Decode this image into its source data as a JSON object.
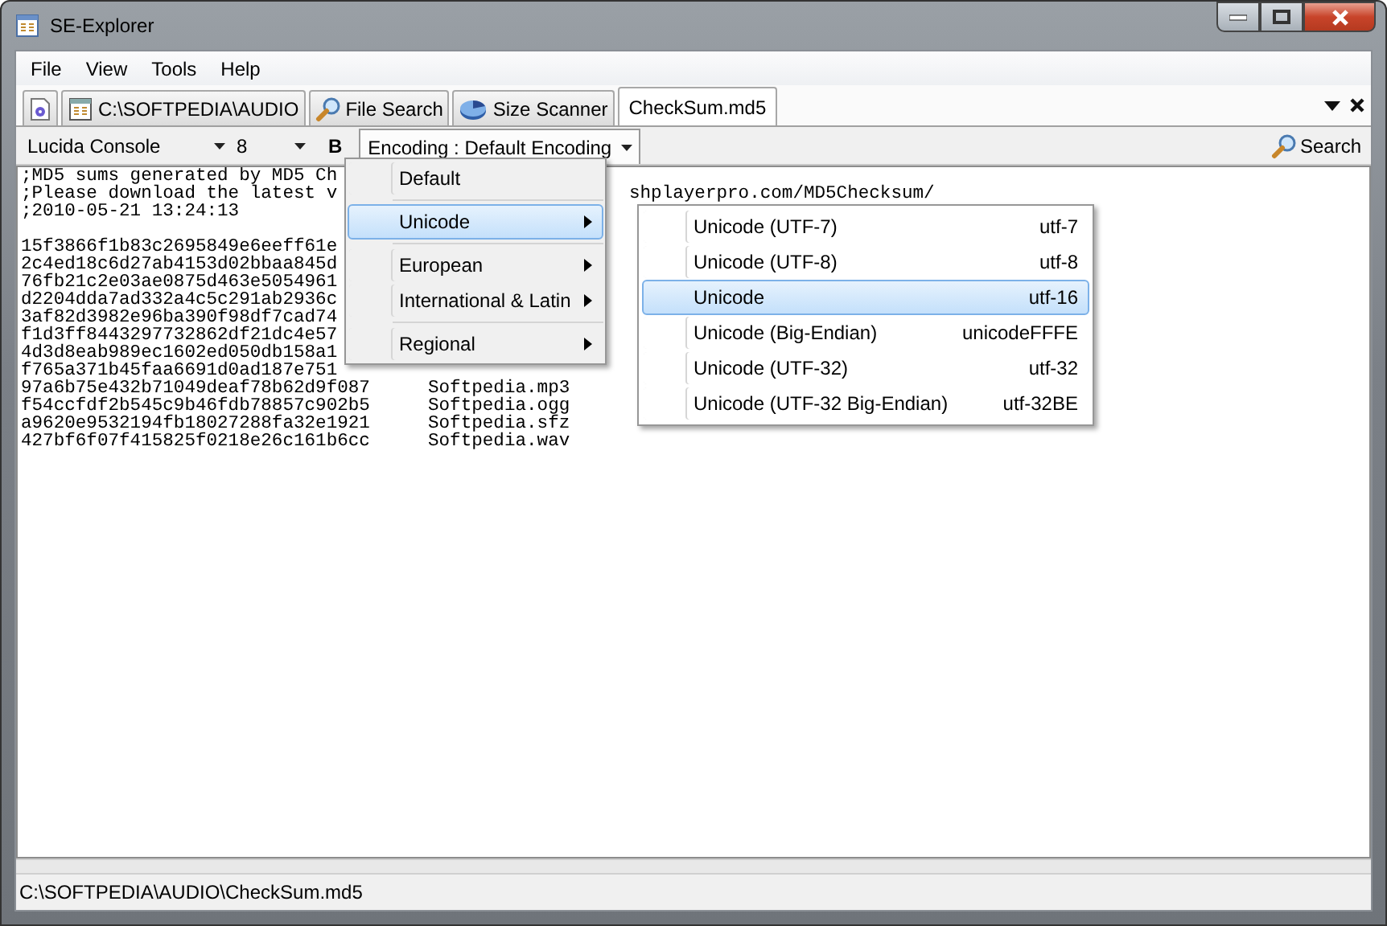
{
  "window": {
    "title": "SE-Explorer"
  },
  "menu_bar": [
    "File",
    "View",
    "Tools",
    "Help"
  ],
  "tabs": [
    {
      "kind": "settings",
      "selected": false
    },
    {
      "kind": "folder",
      "label": "C:\\SOFTPEDIA\\AUDIO",
      "selected": false
    },
    {
      "kind": "search",
      "label": "File Search",
      "selected": false
    },
    {
      "kind": "disk",
      "label": "Size Scanner",
      "selected": false
    },
    {
      "kind": "plain",
      "label": "CheckSum.md5",
      "selected": true
    }
  ],
  "toolbar": {
    "font": "Lucida Console",
    "size": "8",
    "bold": "B",
    "encoding": "Encoding : Default Encoding",
    "search": "Search"
  },
  "editor_header": [
    {
      "text": ";MD5 sums generated by MD5 Ch"
    },
    {
      "text": ";Please download the latest v",
      "tail": "shplayerpro.com/MD5Checksum/"
    },
    {
      "text": ";2010-05-21 13:24:13"
    }
  ],
  "editor_lines": [
    {
      "text": "15f3866f1b83c2695849e6eeff61e"
    },
    {
      "text": "2c4ed18c6d27ab4153d02bbaa845d"
    },
    {
      "text": "76fb21c2e03ae0875d463e5054961"
    },
    {
      "text": "d2204dda7ad332a4c5c291ab2936c"
    },
    {
      "text": "3af82d3982e96ba390f98df7cad74"
    },
    {
      "text": "f1d3ff8443297732862df21dc4e57"
    },
    {
      "text": "4d3d8eab989ec1602ed050db158a1"
    },
    {
      "text": "f765a371b45faa6691d0ad187e751"
    },
    {
      "text": "97a6b75e432b71049deaf78b62d9f087",
      "file": "Softpedia.mp3"
    },
    {
      "text": "f54ccfdf2b545c9b46fdb78857c902b5",
      "file": "Softpedia.ogg"
    },
    {
      "text": "a9620e9532194fb18027288fa32e1921",
      "file": "Softpedia.sfz"
    },
    {
      "text": "427bf6f07f415825f0218e26c161b6cc",
      "file": "Softpedia.wav"
    }
  ],
  "encoding_menu": [
    {
      "kind": "item",
      "label": "Default",
      "submenu": false,
      "selected": false
    },
    {
      "kind": "separator"
    },
    {
      "kind": "item",
      "label": "Unicode",
      "submenu": true,
      "selected": true
    },
    {
      "kind": "separator"
    },
    {
      "kind": "item",
      "label": "European",
      "submenu": true,
      "selected": false
    },
    {
      "kind": "item",
      "label": "International & Latin",
      "submenu": true,
      "selected": false
    },
    {
      "kind": "separator"
    },
    {
      "kind": "item",
      "label": "Regional",
      "submenu": true,
      "selected": false
    }
  ],
  "unicode_submenu": [
    {
      "label": "Unicode (UTF-7)",
      "code": "utf-7",
      "selected": false
    },
    {
      "label": "Unicode (UTF-8)",
      "code": "utf-8",
      "selected": false
    },
    {
      "label": "Unicode",
      "code": "utf-16",
      "selected": true
    },
    {
      "label": "Unicode (Big-Endian)",
      "code": "unicodeFFFE",
      "selected": false
    },
    {
      "label": "Unicode (UTF-32)",
      "code": "utf-32",
      "selected": false
    },
    {
      "label": "Unicode (UTF-32 Big-Endian)",
      "code": "utf-32BE",
      "selected": false
    }
  ],
  "status_bar": "C:\\SOFTPEDIA\\AUDIO\\CheckSum.md5"
}
